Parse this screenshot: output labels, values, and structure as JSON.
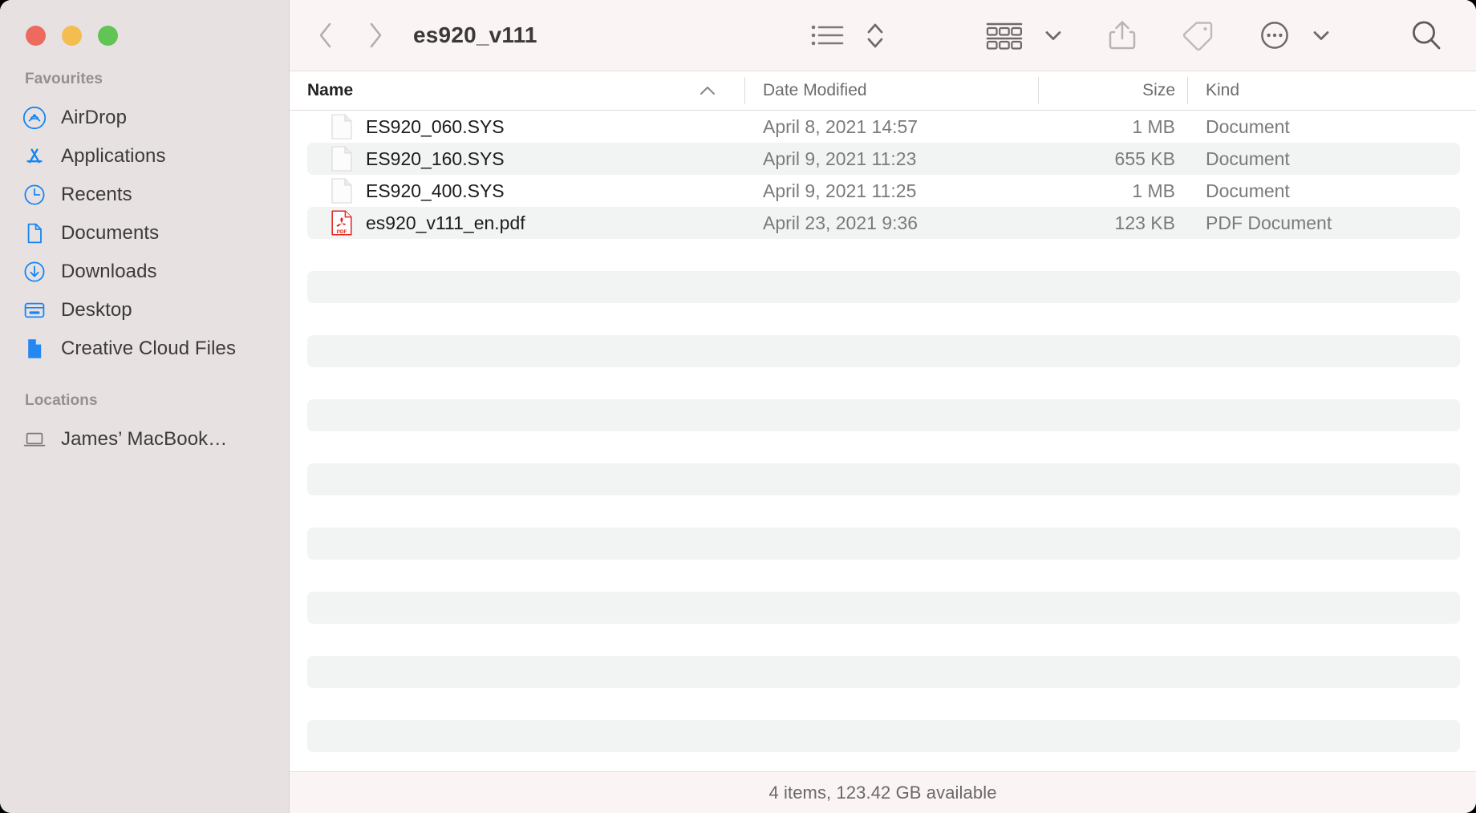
{
  "window": {
    "title": "es920_v111",
    "traffic_lights": [
      {
        "name": "close",
        "color": "#ec6a5e"
      },
      {
        "name": "minimize",
        "color": "#f4bd4f"
      },
      {
        "name": "maximize",
        "color": "#61c454"
      }
    ]
  },
  "sidebar": {
    "sections": [
      {
        "title": "Favourites",
        "items": [
          {
            "label": "AirDrop",
            "icon": "airdrop-icon"
          },
          {
            "label": "Applications",
            "icon": "applications-icon"
          },
          {
            "label": "Recents",
            "icon": "clock-icon"
          },
          {
            "label": "Documents",
            "icon": "document-icon"
          },
          {
            "label": "Downloads",
            "icon": "download-icon"
          },
          {
            "label": "Desktop",
            "icon": "desktop-icon"
          },
          {
            "label": "Creative Cloud Files",
            "icon": "creative-cloud-file-icon"
          }
        ]
      },
      {
        "title": "Locations",
        "items": [
          {
            "label": "James’ MacBook…",
            "icon": "laptop-icon"
          }
        ]
      }
    ]
  },
  "toolbar": {
    "back": "back-button",
    "forward": "forward-button",
    "view_list": "list-view-button",
    "sort": "sort-button",
    "group": "group-by-button",
    "group_chevron": "group-chevron",
    "share": "share-button",
    "tag": "tag-button",
    "more": "more-button",
    "more_chevron": "more-chevron",
    "search": "search-button"
  },
  "columns": [
    {
      "key": "name",
      "label": "Name",
      "sorted": "ascending"
    },
    {
      "key": "date",
      "label": "Date Modified",
      "sorted": ""
    },
    {
      "key": "size",
      "label": "Size",
      "sorted": ""
    },
    {
      "key": "kind",
      "label": "Kind",
      "sorted": ""
    }
  ],
  "files": [
    {
      "name": "ES920_060.SYS",
      "date": "April 8, 2021 14:57",
      "size": "1 MB",
      "kind": "Document",
      "icon": "generic-document-icon"
    },
    {
      "name": "ES920_160.SYS",
      "date": "April 9, 2021 11:23",
      "size": "655 KB",
      "kind": "Document",
      "icon": "generic-document-icon"
    },
    {
      "name": "ES920_400.SYS",
      "date": "April 9, 2021 11:25",
      "size": "1 MB",
      "kind": "Document",
      "icon": "generic-document-icon"
    },
    {
      "name": "es920_v111_en.pdf",
      "date": "April 23, 2021 9:36",
      "size": "123 KB",
      "kind": "PDF Document",
      "icon": "pdf-document-icon"
    }
  ],
  "status": {
    "text": "4 items, 123.42 GB available"
  },
  "colors": {
    "sidebar_bg": "#e7e2e1",
    "toolbar_bg": "#faf5f4",
    "accent_blue": "#1685f5",
    "stripe": "#f2f4f3",
    "pdf_red": "#e2251f"
  }
}
